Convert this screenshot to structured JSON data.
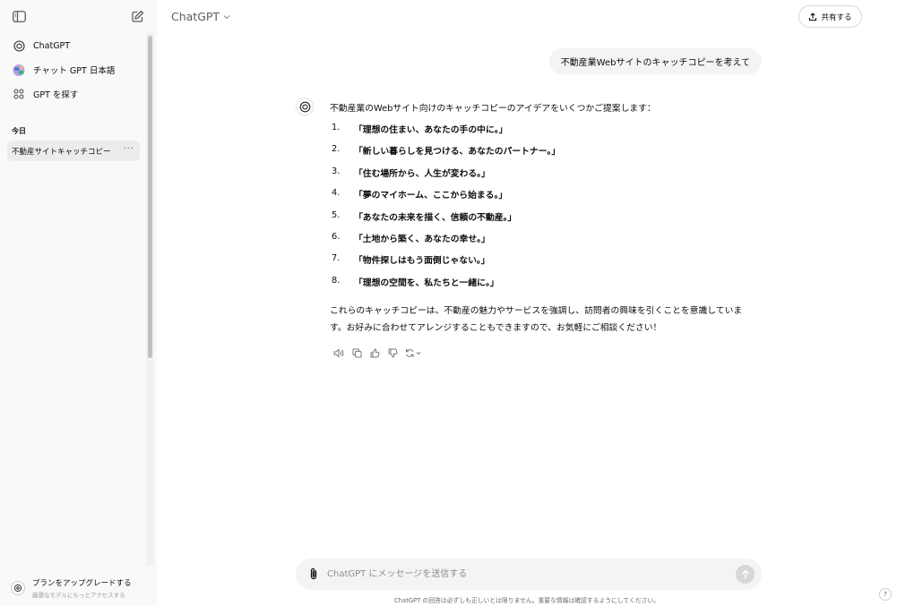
{
  "sidebar": {
    "items": [
      {
        "label": "ChatGPT",
        "icon": "openai-logo-icon"
      },
      {
        "label": "チャット GPT 日本語",
        "icon": "custom-gpt-avatar-icon"
      },
      {
        "label": "GPT を探す",
        "icon": "grid-icon"
      }
    ],
    "section_label": "今日",
    "history": [
      {
        "label": "不動産サイトキャッチコピー"
      }
    ],
    "history_more": "···",
    "upgrade": {
      "title": "プランをアップグレードする",
      "subtitle": "厳選なモデルにもっとアクセスする"
    }
  },
  "header": {
    "model": "ChatGPT",
    "share_label": "共有する"
  },
  "conversation": {
    "user_message": "不動産業Webサイトのキャッチコピーを考えて",
    "assistant": {
      "intro": "不動産業のWebサイト向けのキャッチコピーのアイデアをいくつかご提案します：",
      "items": [
        {
          "num": "1.",
          "text": "「理想の住まい、あなたの手の中に。」"
        },
        {
          "num": "2.",
          "text": "「新しい暮らしを見つける、あなたのパートナー。」"
        },
        {
          "num": "3.",
          "text": "「住む場所から、人生が変わる。」"
        },
        {
          "num": "4.",
          "text": "「夢のマイホーム、ここから始まる。」"
        },
        {
          "num": "5.",
          "text": "「あなたの未来を描く、信頼の不動産。」"
        },
        {
          "num": "6.",
          "text": "「土地から築く、あなたの幸せ。」"
        },
        {
          "num": "7.",
          "text": "「物件探しはもう面倒じゃない。」"
        },
        {
          "num": "8.",
          "text": "「理想の空間を、私たちと一緒に。」"
        }
      ],
      "outro": "これらのキャッチコピーは、不動産の魅力やサービスを強調し、訪問者の興味を引くことを意識しています。お好みに合わせてアレンジすることもできますので、お気軽にご相談ください！"
    }
  },
  "composer": {
    "placeholder": "ChatGPT にメッセージを送信する"
  },
  "footer": {
    "disclaimer": "ChatGPT の回答は必ずしも正しいとは限りません。重要な情報は確認するようにしてください。",
    "help": "?"
  }
}
